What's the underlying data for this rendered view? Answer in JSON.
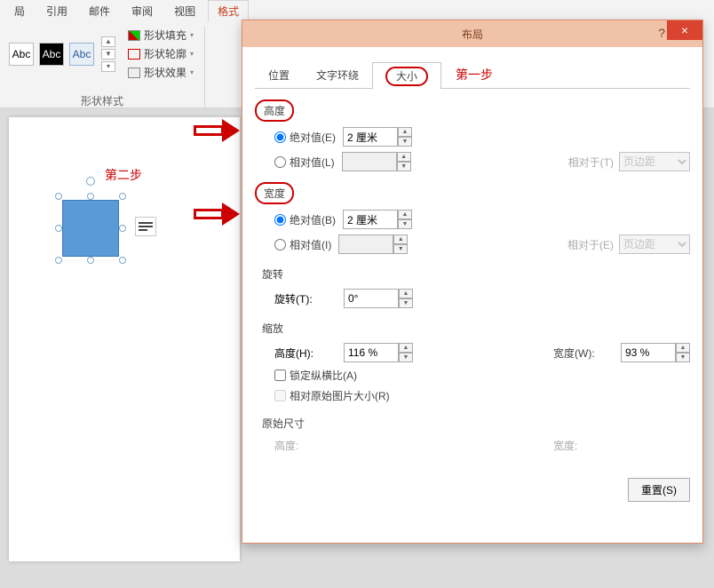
{
  "ribbon": {
    "tabs": [
      "局",
      "引用",
      "邮件",
      "审阅",
      "视图",
      "格式"
    ],
    "active_tab": "格式",
    "style_text": "Abc",
    "fill_label": "形状填充",
    "outline_label": "形状轮廓",
    "effects_label": "形状效果",
    "group_label": "形状样式"
  },
  "annotations": {
    "step1": "第一步",
    "step2": "第二步"
  },
  "dialog": {
    "title": "布局",
    "help": "?",
    "close": "×",
    "tabs": {
      "position": "位置",
      "wrap": "文字环绕",
      "size": "大小"
    },
    "height": {
      "title": "高度",
      "abs_label": "绝对值(E)",
      "abs_value": "2 厘米",
      "rel_label": "相对值(L)",
      "rel_value": "",
      "relative_to_label": "相对于(T)",
      "relative_to_value": "页边距"
    },
    "width": {
      "title": "宽度",
      "abs_label": "绝对值(B)",
      "abs_value": "2 厘米",
      "rel_label": "相对值(I)",
      "rel_value": "",
      "relative_to_label": "相对于(E)",
      "relative_to_value": "页边距"
    },
    "rotate": {
      "title": "旋转",
      "label": "旋转(T):",
      "value": "0°"
    },
    "scale": {
      "title": "缩放",
      "h_label": "高度(H):",
      "h_value": "116 %",
      "w_label": "宽度(W):",
      "w_value": "93 %",
      "lock_label": "锁定纵横比(A)",
      "orig_label": "相对原始图片大小(R)"
    },
    "original": {
      "title": "原始尺寸",
      "h_label": "高度:",
      "w_label": "宽度:"
    },
    "reset": "重置(S)"
  }
}
